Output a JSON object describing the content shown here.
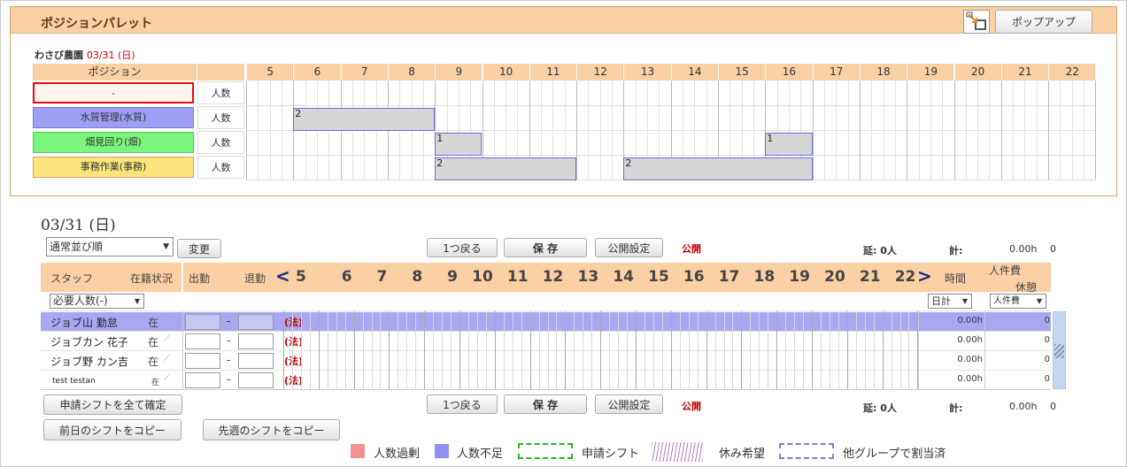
{
  "palette": {
    "title": "ポジションパレット",
    "popup_label": "ポップアップ",
    "farm_name": "わさび農園",
    "farm_date": "03/31 (日)",
    "position_header": "ポジション",
    "hours": [
      "5",
      "6",
      "7",
      "8",
      "9",
      "10",
      "11",
      "12",
      "13",
      "14",
      "15",
      "16",
      "17",
      "18",
      "19",
      "20",
      "21",
      "22"
    ],
    "rows": [
      {
        "name": "-",
        "color": "#fff5ef",
        "border": "#e01010",
        "label": "人数"
      },
      {
        "name": "水質管理(水質)",
        "color": "#9e9ef5",
        "border": "#7a7ad8",
        "label": "人数"
      },
      {
        "name": "畑見回り(畑)",
        "color": "#7cf57c",
        "border": "#58c858",
        "label": "人数"
      },
      {
        "name": "事務作業(事務)",
        "color": "#fbe57c",
        "border": "#d5a25f",
        "label": "人数"
      }
    ],
    "bars": [
      {
        "row": 1,
        "start": 6,
        "end": 9,
        "count": "2"
      },
      {
        "row": 2,
        "start": 9,
        "end": 10,
        "count": "1"
      },
      {
        "row": 2,
        "start": 16,
        "end": 17,
        "count": "1"
      },
      {
        "row": 3,
        "start": 9,
        "end": 12,
        "count": "2"
      },
      {
        "row": 3,
        "start": 13,
        "end": 17,
        "count": "2"
      }
    ]
  },
  "day": {
    "title": "03/31 (日)",
    "sort_select": "通常並び順",
    "change_btn": "変更",
    "undo_btn": "1つ戻る",
    "save_btn": "保 存",
    "publish_btn": "公開設定",
    "public_status": "公開",
    "total_people": "延: 0人",
    "total_label": "計:",
    "total_hours": "0.00h",
    "total_cost": "0"
  },
  "grid": {
    "staff_col": "スタッフ",
    "status_col": "在籍状況",
    "start_col": "出勤",
    "end_col": "退勤",
    "prev_arrow": "<",
    "next_arrow": ">",
    "hours": [
      "5",
      "6",
      "7",
      "8",
      "9",
      "10",
      "11",
      "12",
      "13",
      "14",
      "15",
      "16",
      "17",
      "18",
      "19",
      "20",
      "21",
      "22"
    ],
    "time_col": "時間",
    "cost_col": "人件費",
    "break_col": "休憩",
    "required_select": "必要人数(-)",
    "daily_select": "日計",
    "cost_select": "人件費",
    "staff": [
      {
        "name": "ジョブ山 勤怠",
        "status": "在",
        "legal": "(法)",
        "hours": "0.00h",
        "cost": "0",
        "highlight": true
      },
      {
        "name": "ジョブカン 花子",
        "status": "在",
        "legal": "(法)",
        "hours": "0.00h",
        "cost": "0",
        "highlight": false
      },
      {
        "name": "ジョブ野 カン吉",
        "status": "在",
        "legal": "(法)",
        "hours": "0.00h",
        "cost": "0",
        "highlight": false
      },
      {
        "name": "test testan",
        "status": "在",
        "legal": "(法)",
        "hours": "0.00h",
        "cost": "0",
        "highlight": false
      }
    ],
    "separator": "-"
  },
  "bottom": {
    "confirm_btn": "申請シフトを全て確定",
    "copy_prev_day_btn": "前日のシフトをコピー",
    "copy_prev_week_btn": "先週のシフトをコピー",
    "undo_btn": "1つ戻る",
    "save_btn": "保 存",
    "publish_btn": "公開設定",
    "public_status": "公開",
    "total_people": "延: 0人",
    "total_label": "計:",
    "total_hours": "0.00h",
    "total_cost": "0"
  },
  "legend": [
    {
      "label": "人数過剰",
      "color": "#f49090",
      "style": "solid"
    },
    {
      "label": "人数不足",
      "color": "#9090f0",
      "style": "solid"
    },
    {
      "label": "申請シフト",
      "color": "#22b822",
      "style": "dashed"
    },
    {
      "label": "休み希望",
      "color": "#a070c0",
      "style": "hatched"
    },
    {
      "label": "他グループで割当済",
      "color": "#8080c8",
      "style": "dashed"
    }
  ]
}
